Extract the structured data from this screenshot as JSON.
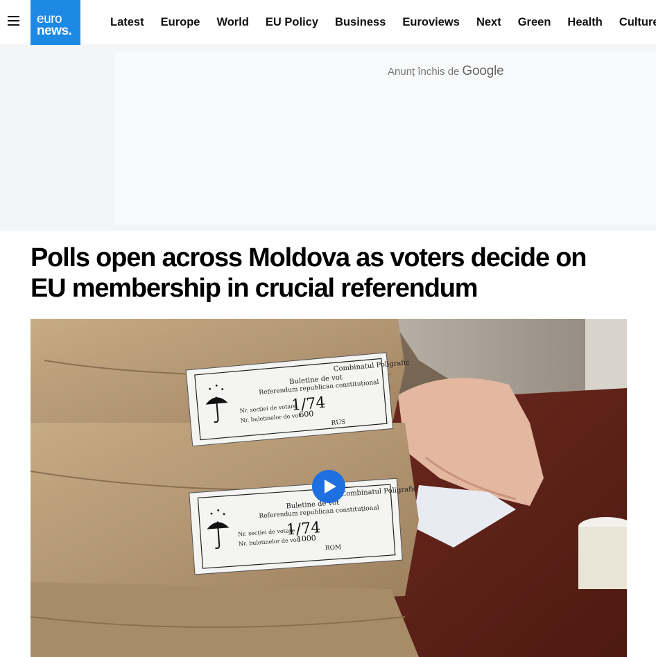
{
  "header": {
    "logo_line1": "euro",
    "logo_line2": "news.",
    "nav": [
      "Latest",
      "Europe",
      "World",
      "EU Policy",
      "Business",
      "Euroviews",
      "Next",
      "Green",
      "Health",
      "Culture"
    ]
  },
  "ad": {
    "closed_text": "Anunț închis de",
    "google": "Google"
  },
  "article": {
    "headline": "Polls open across Moldova as voters decide on EU membership in crucial referendum"
  },
  "video": {
    "label1": {
      "company": "Combinatul Poligrafic",
      "title": "Buletine de vot",
      "subtitle": "Referendum republican constituțional",
      "section_label": "Nr. secției de votare",
      "section_value": "1/74",
      "ballots_label": "Nr. buletinelor de vot",
      "ballots_value": "600",
      "lang": "RUS"
    },
    "label2": {
      "company": "Combinatul Poligrafic",
      "title": "Buletine de vot",
      "subtitle": "Referendum republican constituțional",
      "section_label": "Nr. secției de votare",
      "section_value": "1/74",
      "ballots_label": "Nr. buletinelor de vot",
      "ballots_value": "1000",
      "lang": "ROM"
    }
  },
  "colors": {
    "brand_blue": "#1e88e5",
    "play_blue": "#1e6fe0"
  }
}
